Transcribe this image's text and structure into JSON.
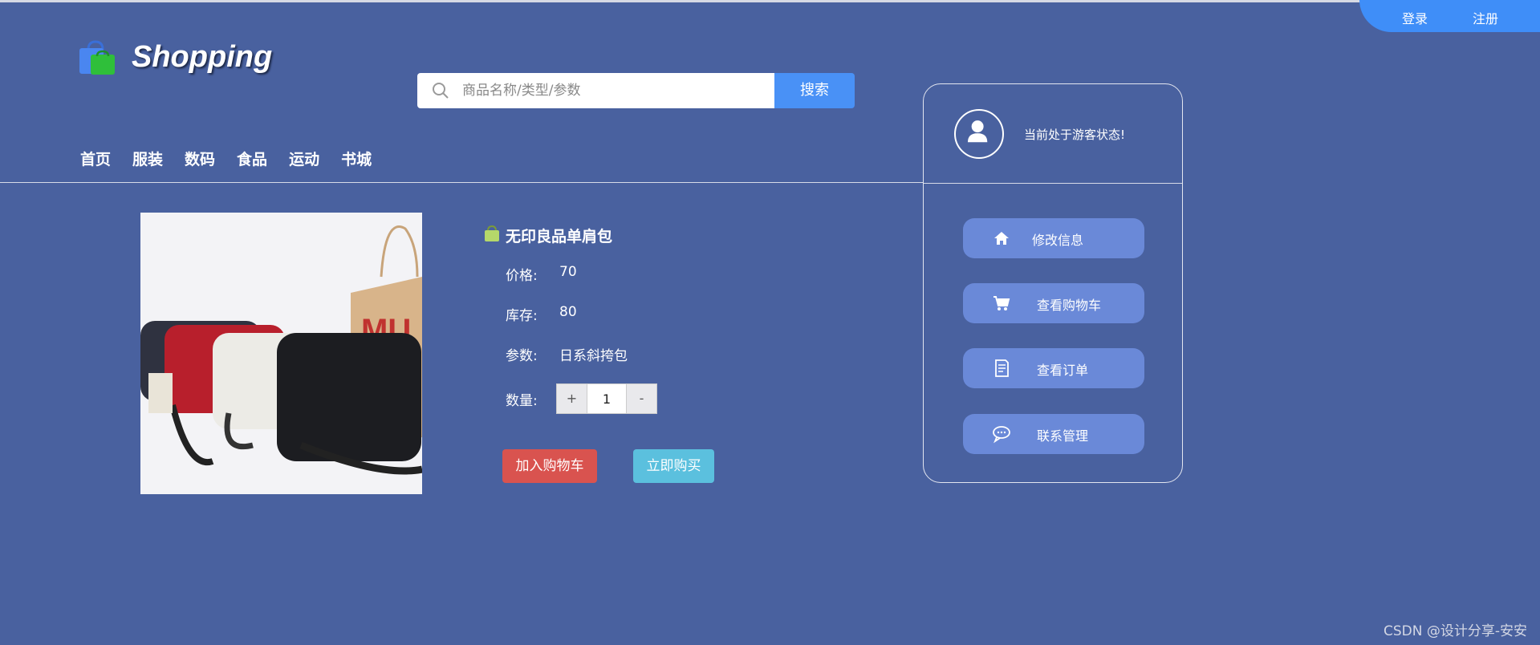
{
  "auth": {
    "login": "登录",
    "register": "注册"
  },
  "brand": {
    "name": "Shopping"
  },
  "search": {
    "placeholder": "商品名称/类型/参数",
    "button": "搜索"
  },
  "nav": [
    "首页",
    "服装",
    "数码",
    "食品",
    "运动",
    "书城"
  ],
  "product": {
    "title": "无印良品单肩包",
    "price_label": "价格:",
    "price": "70",
    "stock_label": "库存:",
    "stock": "80",
    "param_label": "参数:",
    "param": "日系斜挎包",
    "qty_label": "数量:",
    "qty_plus": "+",
    "qty_value": "1",
    "qty_minus": "-",
    "add_to_cart": "加入购物车",
    "buy_now": "立即购买",
    "bag_colors": [
      "#2f3240",
      "#b81f2c",
      "#ecebe6",
      "#1c1d21"
    ]
  },
  "user_panel": {
    "status": "当前处于游客状态!",
    "menu": [
      {
        "label": "修改信息",
        "icon": "home-icon"
      },
      {
        "label": "查看购物车",
        "icon": "cart-icon"
      },
      {
        "label": "查看订单",
        "icon": "order-icon"
      },
      {
        "label": "联系管理",
        "icon": "chat-icon"
      }
    ]
  },
  "watermark": "CSDN @设计分享-安安",
  "colors": {
    "background": "#49619f",
    "primary": "#4991f6",
    "danger": "#d9534f",
    "info": "#5bc0de",
    "menu_button": "#6a89d8"
  }
}
